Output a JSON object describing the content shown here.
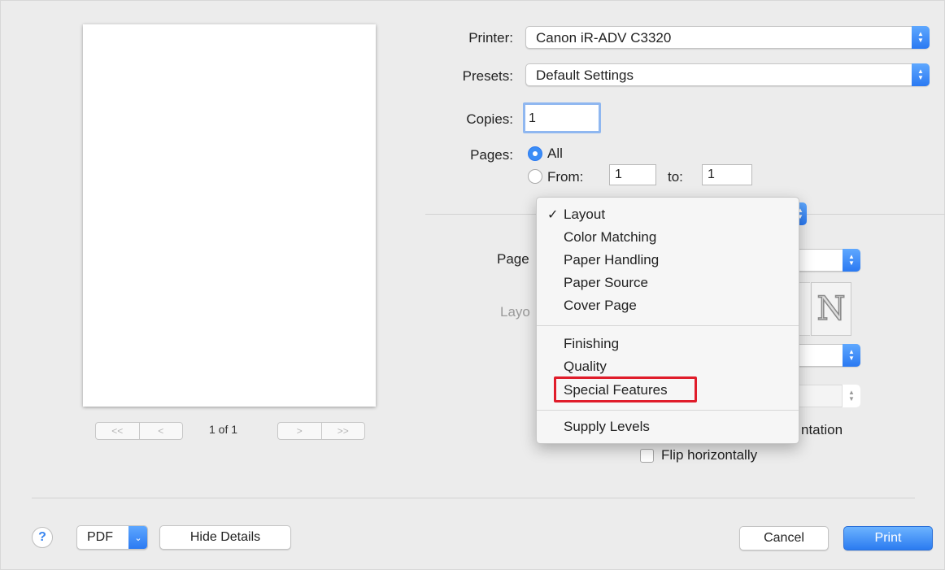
{
  "preview": {
    "page_count": "1 of 1",
    "nav_first": "<<",
    "nav_prev": "<",
    "nav_next": ">",
    "nav_last": ">>"
  },
  "printer": {
    "label": "Printer:",
    "value": "Canon iR-ADV C3320"
  },
  "presets": {
    "label": "Presets:",
    "value": "Default Settings"
  },
  "copies": {
    "label": "Copies:",
    "value": "1"
  },
  "pages": {
    "label": "Pages:",
    "all_label": "All",
    "from_label": "From:",
    "from_value": "1",
    "to_label": "to:",
    "to_value": "1"
  },
  "behind": {
    "page_label": "Page",
    "layout_label": "Layo",
    "orientation_tail": "ntation",
    "flip_label": "Flip horizontally"
  },
  "menu": {
    "checked": "✓",
    "group1": [
      "Layout",
      "Color Matching",
      "Paper Handling",
      "Paper Source",
      "Cover Page"
    ],
    "group2": [
      "Finishing",
      "Quality",
      "Special Features"
    ],
    "group3": [
      "Supply Levels"
    ]
  },
  "footer": {
    "help": "?",
    "pdf_label": "PDF",
    "hide_details": "Hide Details",
    "cancel": "Cancel",
    "print": "Print"
  },
  "colors": {
    "accent": "#2a79f2",
    "highlight": "#e01c2a"
  }
}
